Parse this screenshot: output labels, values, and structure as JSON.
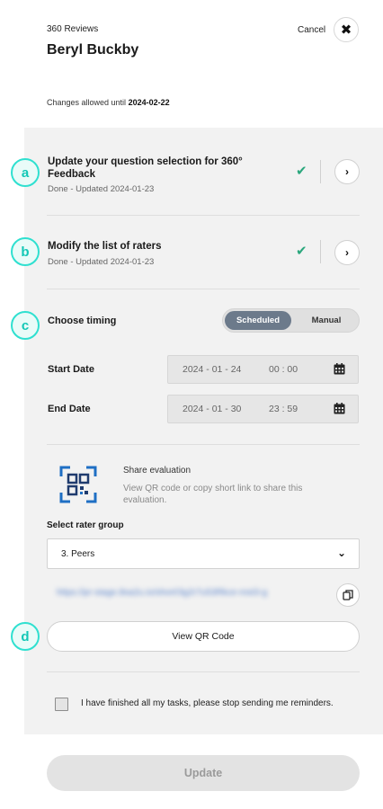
{
  "header": {
    "subtitle": "360 Reviews",
    "title": "Beryl Buckby",
    "cancel_label": "Cancel",
    "changes_prefix": "Changes allowed until ",
    "changes_date": "2024-02-22"
  },
  "steps": [
    {
      "badge": "a",
      "title": "Update your question selection for 360° Feedback",
      "status": "Done - Updated 2024-01-23"
    },
    {
      "badge": "b",
      "title": "Modify the list of raters",
      "status": "Done - Updated 2024-01-23"
    }
  ],
  "timing": {
    "badge": "c",
    "label": "Choose timing",
    "options": [
      "Scheduled",
      "Manual"
    ],
    "selected": "Scheduled",
    "start": {
      "label": "Start Date",
      "date": "2024 - 01 - 24",
      "time": "00 : 00"
    },
    "end": {
      "label": "End Date",
      "date": "2024 - 01 - 30",
      "time": "23 : 59"
    }
  },
  "share": {
    "title": "Share evaluation",
    "description": "View QR code or copy short link to share this evaluation.",
    "select_label": "Select rater group",
    "selected_group": "3. Peers",
    "short_link": "https://pr-stage.8sa2u.io/short/3g2r7u53Rkce-mst3-g",
    "badge": "d",
    "qr_button": "View QR Code"
  },
  "reminder_label": "I have finished all my tasks, please stop sending me reminders.",
  "update_button": "Update",
  "colors": {
    "badge_teal": "#2fe0d0",
    "check_green": "#2aa77c",
    "toggle_active": "#6c7a8b",
    "qr_icon_blue": "#1f6fc4"
  }
}
